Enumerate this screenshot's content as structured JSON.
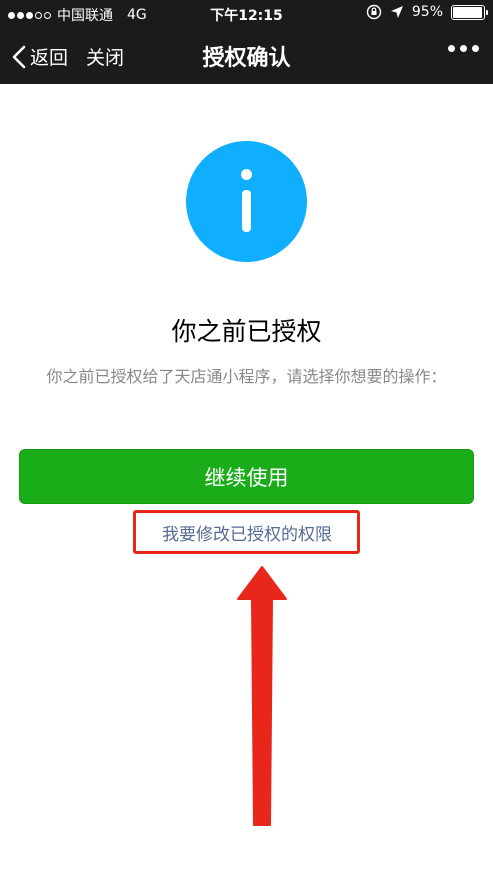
{
  "status_bar": {
    "carrier": "中国联通",
    "network": "4G",
    "time": "下午12:15",
    "battery": "95%",
    "battery_level": 0.95
  },
  "nav": {
    "back_label": "返回",
    "close_label": "关闭",
    "title": "授权确认",
    "more_icon": "more-dots-icon"
  },
  "main": {
    "icon": "info-icon",
    "icon_color": "#10aeff",
    "title": "你之前已授权",
    "description": "你之前已授权给了天店通小程序，请选择你想要的操作：",
    "continue_button": "继续使用",
    "modify_link": "我要修改已授权的权限"
  },
  "colors": {
    "nav_background": "#1b1b1d",
    "primary_button": "#1aad19",
    "link": "#576b95",
    "annotation": "#e8261c"
  }
}
